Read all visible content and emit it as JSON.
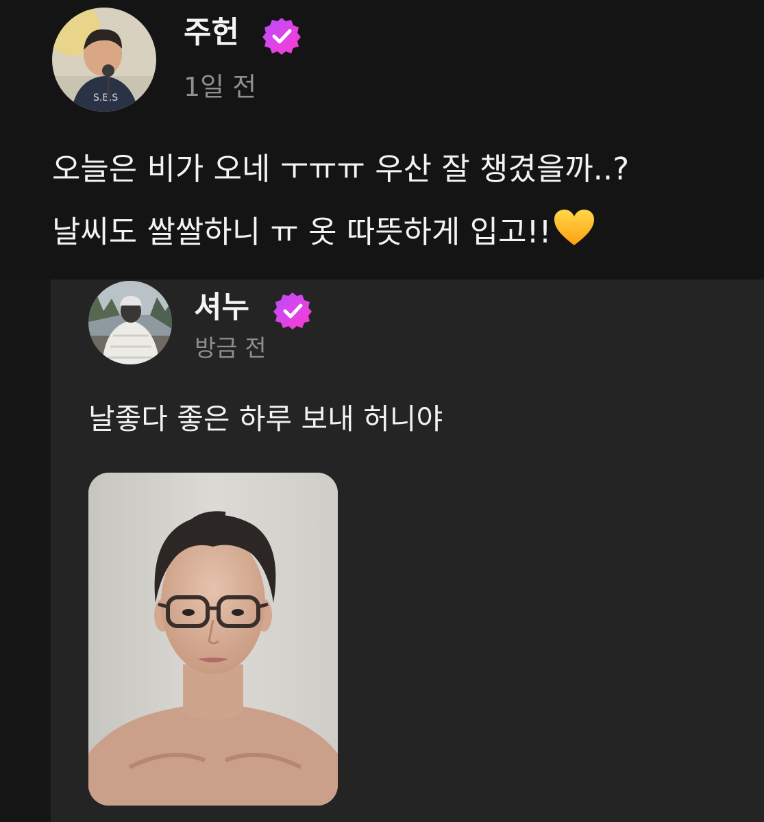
{
  "post": {
    "author": "주헌",
    "time": "1일 전",
    "line1": "오늘은 비가 오네 ㅜㅠㅠ 우산 잘 챙겼을까..?",
    "line2": "날씨도 쌀쌀하니 ㅠ 옷 따뜻하게 입고!!",
    "heart_emoji": "yellow-heart",
    "avatar_desc": "child photo avatar"
  },
  "reply": {
    "author": "셔누",
    "time": "방금 전",
    "text": "날좋다 좋은 하루 보내 허니야",
    "avatar_desc": "person in white padded jacket avatar"
  },
  "colors": {
    "badge_gradient_start": "#b84dff",
    "badge_gradient_end": "#ff3bd0",
    "background": "#141414",
    "reply_background": "#242424",
    "heart": "#ffc21a"
  }
}
